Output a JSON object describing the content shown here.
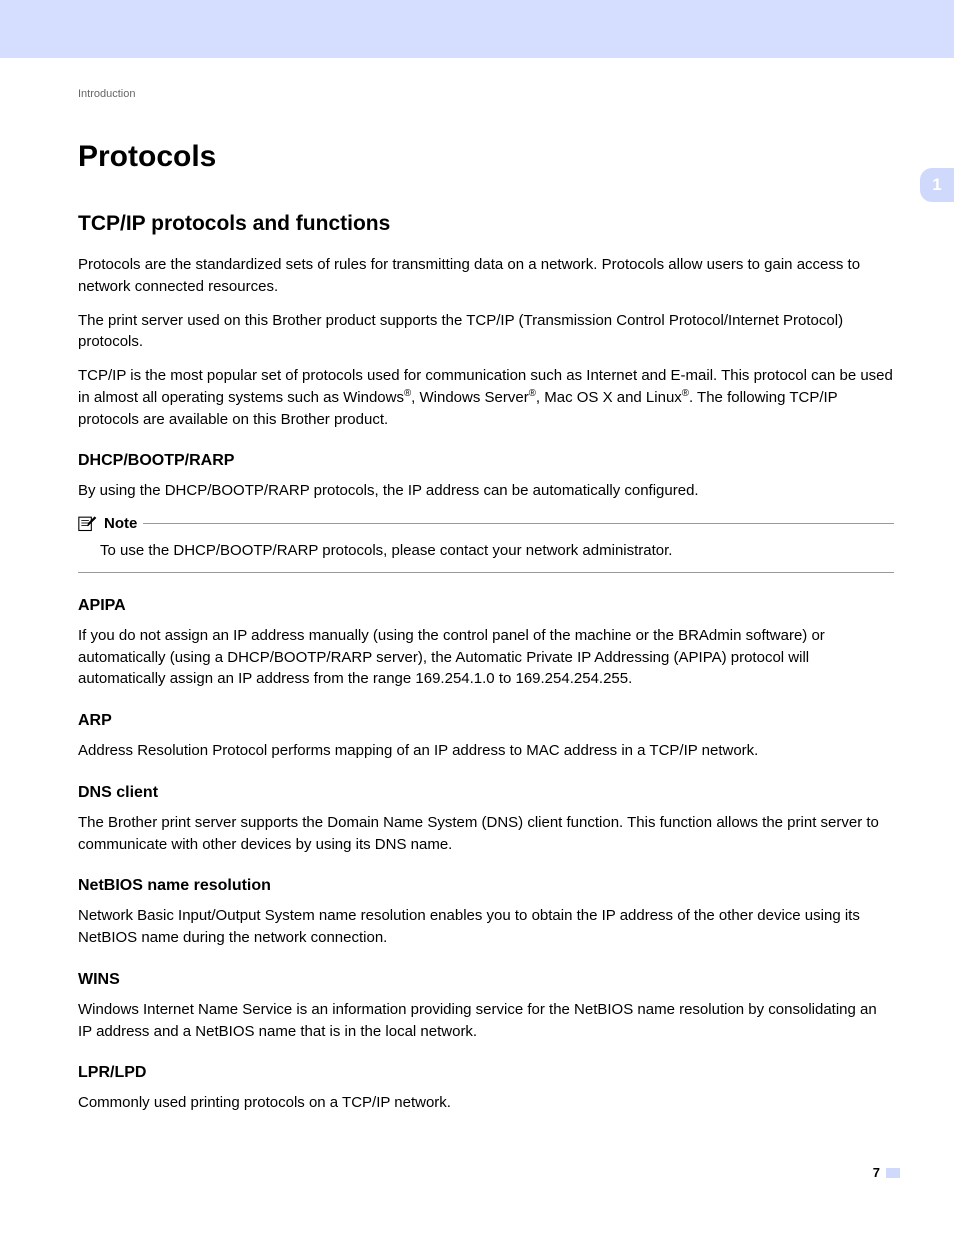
{
  "breadcrumb": "Introduction",
  "chapter_tab": "1",
  "page_number": "7",
  "h1": "Protocols",
  "h2": "TCP/IP protocols and functions",
  "intro_p1": "Protocols are the standardized sets of rules for transmitting data on a network. Protocols allow users to gain access to network connected resources.",
  "intro_p2": "The print server used on this Brother product supports the TCP/IP (Transmission Control Protocol/Internet Protocol) protocols.",
  "intro_p3_a": "TCP/IP is the most popular set of protocols used for communication such as Internet and E-mail. This protocol can be used in almost all operating systems such as Windows",
  "intro_p3_b": ", Windows Server",
  "intro_p3_c": ", Mac OS X and Linux",
  "intro_p3_d": ". The following TCP/IP protocols are available on this Brother product.",
  "reg": "®",
  "sections": {
    "dhcp": {
      "title": "DHCP/BOOTP/RARP",
      "body": "By using the DHCP/BOOTP/RARP protocols, the IP address can be automatically configured."
    },
    "note": {
      "label": "Note",
      "body": "To use the DHCP/BOOTP/RARP protocols, please contact your network administrator."
    },
    "apipa": {
      "title": "APIPA",
      "body": "If you do not assign an IP address manually (using the control panel of the machine or the BRAdmin software) or automatically (using a DHCP/BOOTP/RARP server), the Automatic Private IP Addressing (APIPA) protocol will automatically assign an IP address from the range 169.254.1.0 to 169.254.254.255."
    },
    "arp": {
      "title": "ARP",
      "body": "Address Resolution Protocol performs mapping of an IP address to MAC address in a TCP/IP network."
    },
    "dns": {
      "title": "DNS client",
      "body": "The Brother print server supports the Domain Name System (DNS) client function. This function allows the print server to communicate with other devices by using its DNS name."
    },
    "netbios": {
      "title": "NetBIOS name resolution",
      "body": "Network Basic Input/Output System name resolution enables you to obtain the IP address of the other device using its NetBIOS name during the network connection."
    },
    "wins": {
      "title": "WINS",
      "body": "Windows Internet Name Service is an information providing service for the NetBIOS name resolution by consolidating an IP address and a NetBIOS name that is in the local network."
    },
    "lpr": {
      "title": "LPR/LPD",
      "body": "Commonly used printing protocols on a TCP/IP network."
    }
  }
}
